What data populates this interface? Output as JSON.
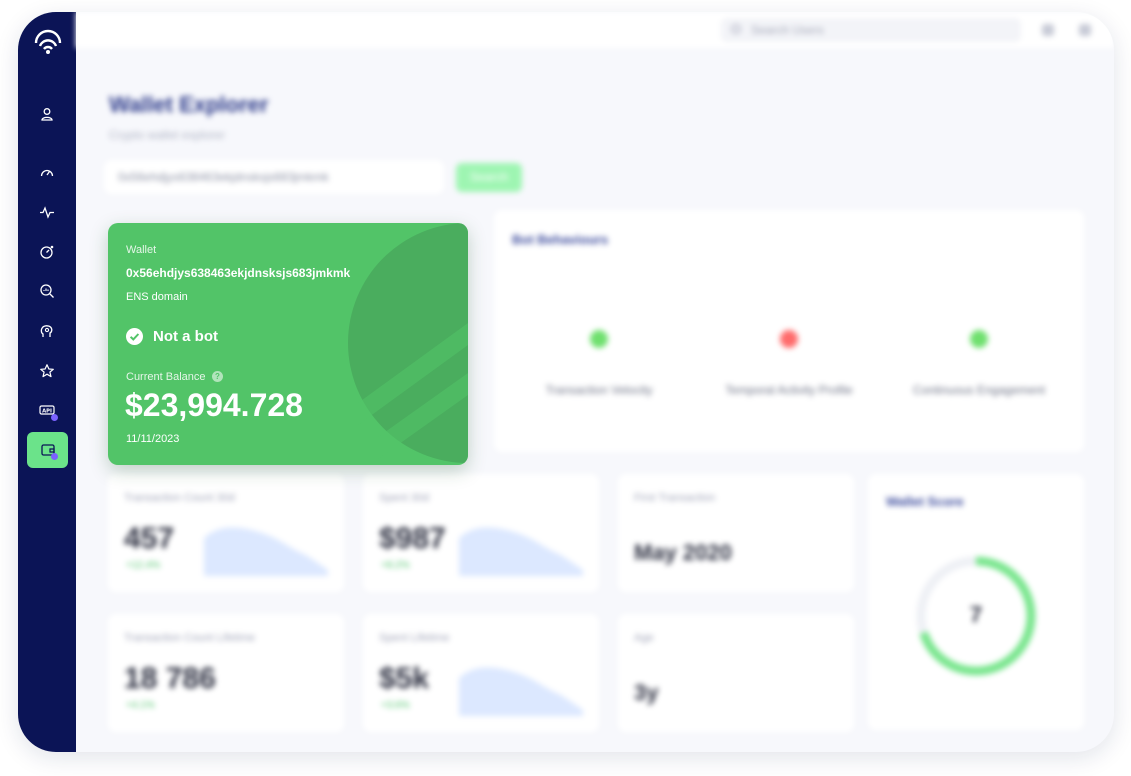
{
  "sidebar": {
    "items": [
      {
        "name": "user-icon",
        "active": false
      },
      {
        "name": "gauge-icon",
        "active": false
      },
      {
        "name": "pulse-icon",
        "active": false
      },
      {
        "name": "chart-gauge-icon",
        "active": false
      },
      {
        "name": "search-analytics-icon",
        "active": false
      },
      {
        "name": "brain-icon",
        "active": false
      },
      {
        "name": "star-icon",
        "active": false
      },
      {
        "name": "api-icon",
        "active": false
      },
      {
        "name": "wallet-icon",
        "active": true
      }
    ]
  },
  "topbar": {
    "search_placeholder": "Search Users"
  },
  "page": {
    "title": "Wallet Explorer",
    "subtitle": "Crypto wallet explorer",
    "address_input": "0x56ehdjys638463ekjdnsksjs683jmkmk",
    "search_button": "Search"
  },
  "wallet": {
    "label": "Wallet",
    "address": "0x56ehdjys638463ekjdnsksjs683jmkmk",
    "ens_label": "ENS domain",
    "bot_status": "Not a bot",
    "balance_label": "Current Balance",
    "balance_help": "?",
    "balance": "$23,994.728",
    "date": "11/11/2023"
  },
  "bot_behaviour": {
    "title": "Bot Behaviours",
    "items": [
      {
        "label": "Transaction Velocity",
        "status_color": "#6fe06e"
      },
      {
        "label": "Temporal Activity Profile",
        "status_color": "#ff6b6b"
      },
      {
        "label": "Continuous Engagement",
        "status_color": "#6fe06e"
      }
    ]
  },
  "stats": [
    {
      "label": "Transaction Count 30d",
      "value": "457",
      "change": "+12.4%"
    },
    {
      "label": "Spent 30d",
      "value": "$987",
      "change": "+8.2%"
    },
    {
      "label": "First Transaction",
      "value": "May 2020",
      "change": ""
    },
    {
      "label": "Transaction Count Lifetime",
      "value": "18 786",
      "change": "+4.1%"
    },
    {
      "label": "Spent Lifetime",
      "value": "$5k",
      "change": "+3.6%"
    },
    {
      "label": "Age",
      "value": "3y",
      "change": ""
    }
  ],
  "wallet_score": {
    "title": "Wallet Score",
    "value": "7",
    "fraction": 0.7
  },
  "colors": {
    "sidebar": "#0b1456",
    "wallet_card": "#52c468",
    "accent": "#6be38a",
    "badge": "#7b62ff"
  }
}
